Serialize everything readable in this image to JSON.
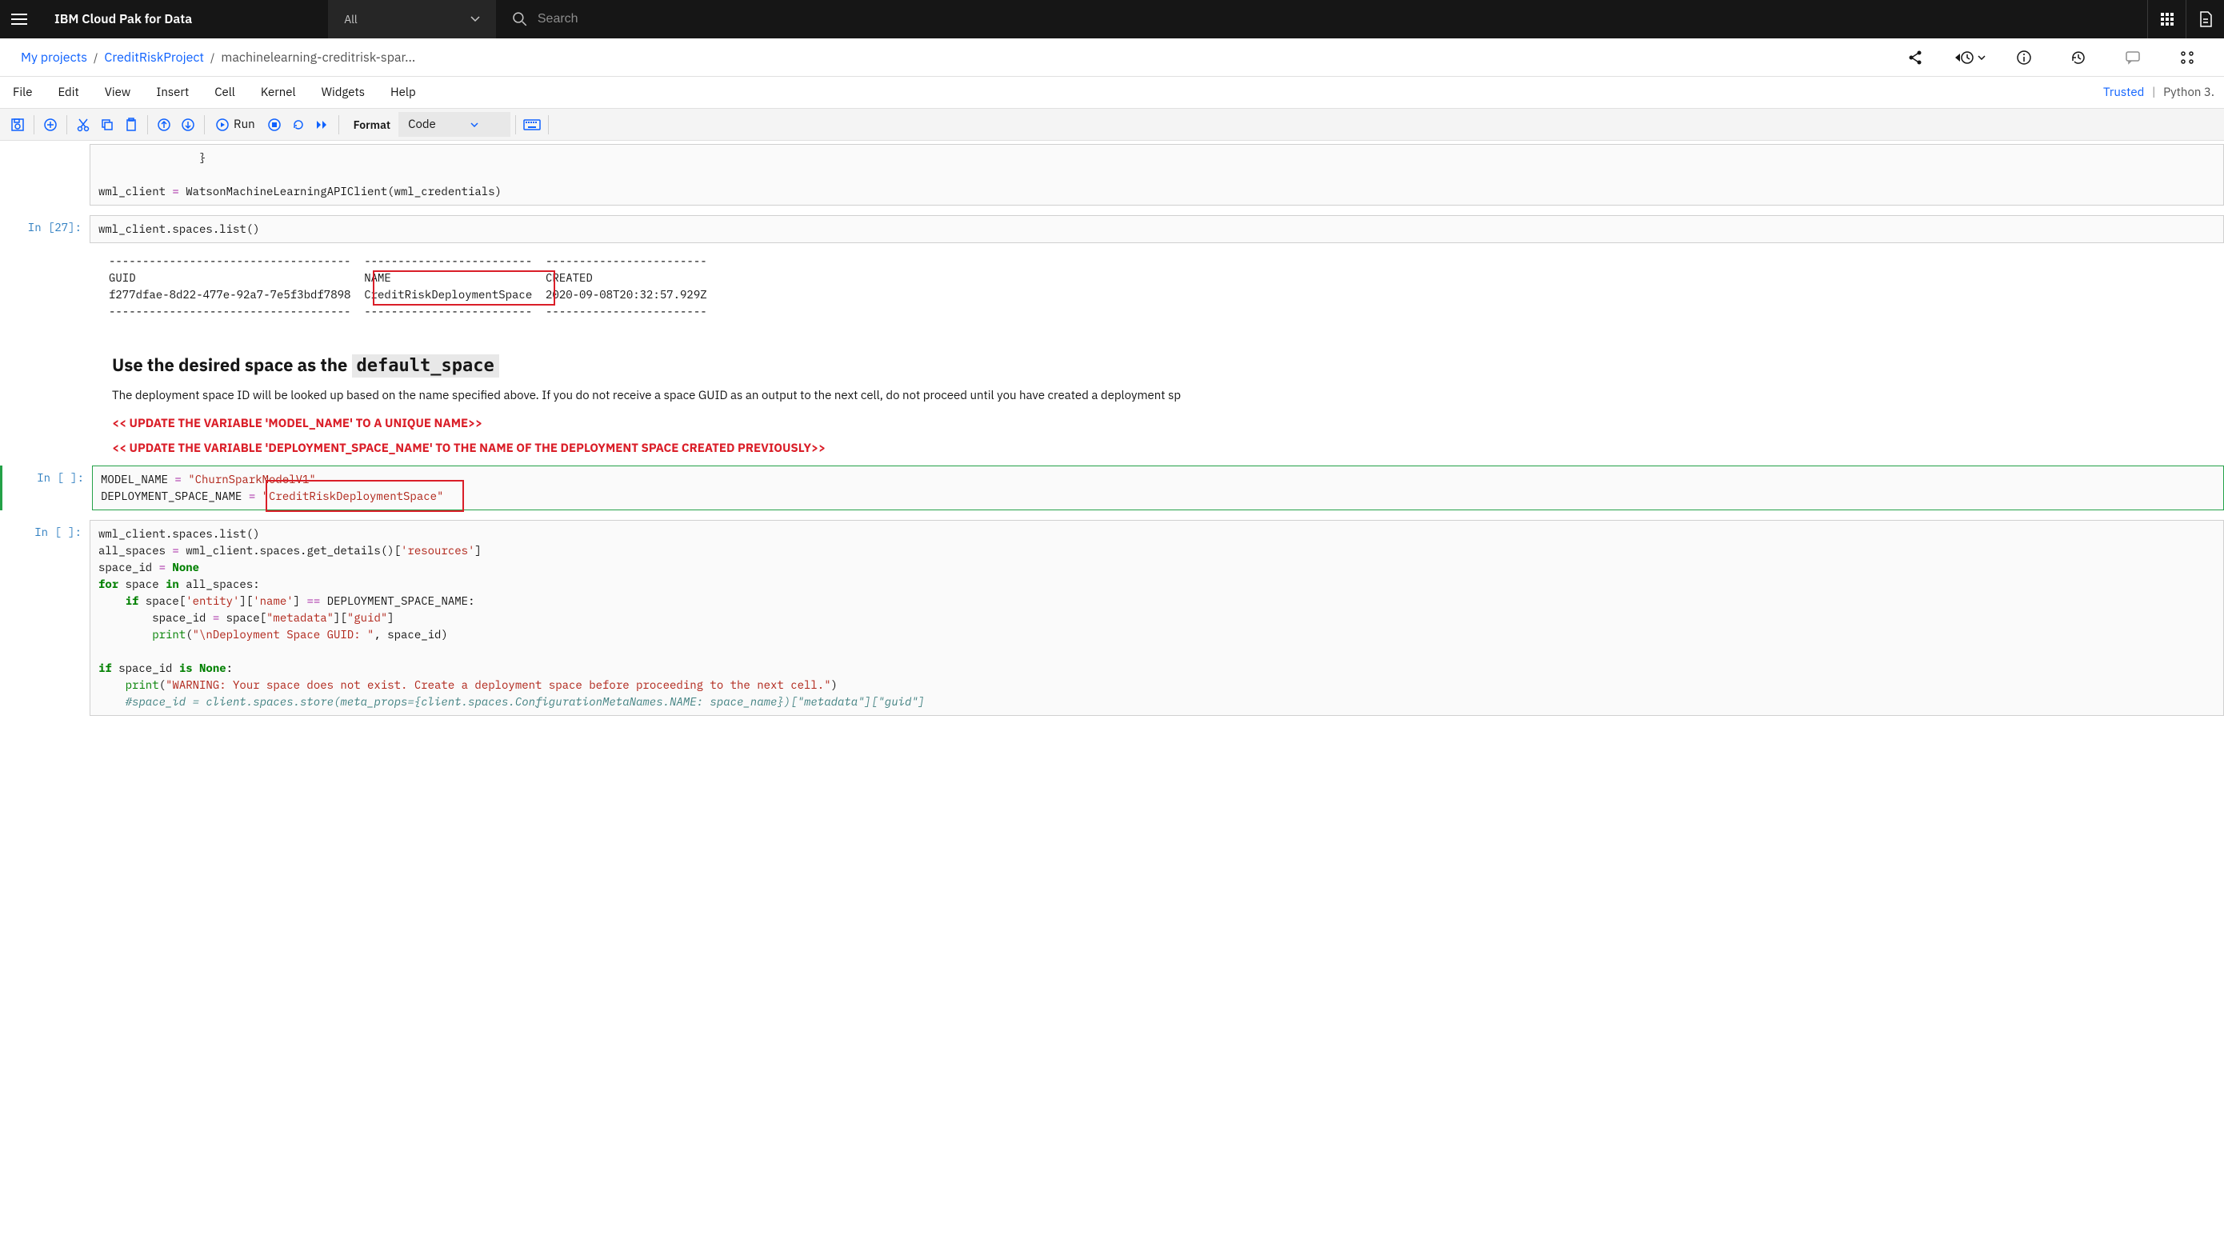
{
  "header": {
    "brand": "IBM Cloud Pak for Data",
    "dropdown_label": "All",
    "search_placeholder": "Search"
  },
  "breadcrumb": {
    "root": "My projects",
    "project": "CreditRiskProject",
    "file": "machinelearning-creditrisk-spar..."
  },
  "menubar": {
    "file": "File",
    "edit": "Edit",
    "view": "View",
    "insert": "Insert",
    "cell": "Cell",
    "kernel": "Kernel",
    "widgets": "Widgets",
    "help": "Help",
    "trusted": "Trusted",
    "kernel_name": "Python 3."
  },
  "toolbar": {
    "run_label": "Run",
    "format_label": "Format",
    "format_value": "Code"
  },
  "cells": {
    "c0": {
      "closing_brace": "               }",
      "code": "wml_client = WatsonMachineLearningAPIClient(wml_credentials)"
    },
    "c1": {
      "prompt": "In [27]:",
      "code": "wml_client.spaces.list()",
      "output": {
        "h_guid": "GUID",
        "h_name": "NAME",
        "h_created": "CREATED",
        "guid": "f277dfae-8d22-477e-92a7-7e5f3bdf7898",
        "name": "CreditRiskDeploymentSpace",
        "created": "2020-09-08T20:32:57.929Z",
        "dash1": "------------------------------------",
        "dash2": "-------------------------",
        "dash3": "------------------------"
      }
    },
    "md": {
      "h3_pre": "Use the desired space as the ",
      "h3_code": "default_space",
      "p": "The deployment space ID will be looked up based on the name specified above. If you do not receive a space GUID as an output to the next cell, do not proceed until you have created a deployment sp",
      "warn1": "<< UPDATE THE VARIABLE 'MODEL_NAME' TO A UNIQUE NAME>>",
      "warn2": "<< UPDATE THE VARIABLE 'DEPLOYMENT_SPACE_NAME' TO THE NAME OF THE DEPLOYMENT SPACE CREATED PREVIOUSLY>>"
    },
    "c2": {
      "prompt": "In [ ]:",
      "model_var": "MODEL_NAME",
      "model_val": "\"ChurnSparkModelV1\"",
      "dep_var": "DEPLOYMENT_SPACE_NAME",
      "dep_val": "\"CreditRiskDeploymentSpace\""
    },
    "c3": {
      "prompt": "In [ ]:"
    }
  }
}
